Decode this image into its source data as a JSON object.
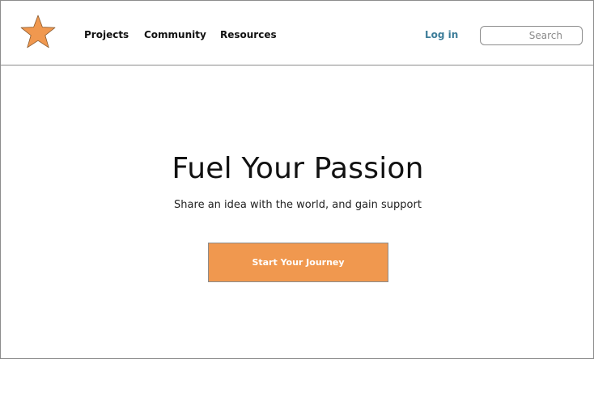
{
  "brand": {
    "logo_icon": "star-icon",
    "logo_color": "#f0984f"
  },
  "nav": {
    "items": [
      {
        "label": "Projects"
      },
      {
        "label": "Community"
      },
      {
        "label": "Resources"
      }
    ],
    "login_label": "Log in",
    "login_color": "#3d7d99"
  },
  "search": {
    "placeholder": "Search",
    "value": ""
  },
  "hero": {
    "title": "Fuel Your Passion",
    "subtitle": "Share an idea with the world, and gain support",
    "cta_label": "Start Your Journey",
    "cta_color": "#f0984f"
  }
}
